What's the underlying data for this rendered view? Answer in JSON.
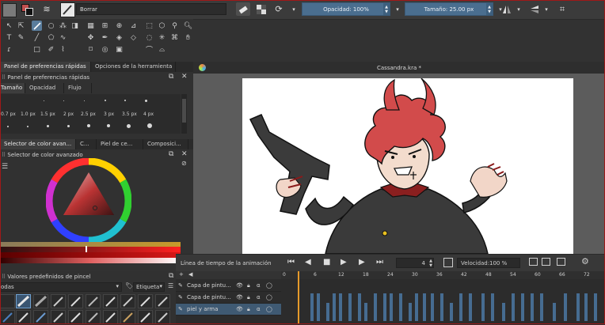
{
  "toolbar": {
    "brush_preset": "Borrar",
    "opacity": "Opacidad: 100%",
    "size": "Tamaño: 25.00 px"
  },
  "tabs_top": [
    "Panel de preferencias rápidas",
    "Opciones de la herramienta"
  ],
  "quick_panel": {
    "title": "Panel de preferencias rápidas",
    "tabs": [
      "Tamaño",
      "Opacidad",
      "Flujo"
    ],
    "sizes": [
      "0.7 px",
      "1.0 px",
      "1.5 px",
      "2 px",
      "2.5 px",
      "3 px",
      "3.5 px",
      "4 px"
    ]
  },
  "color_tabs": [
    "Selector de color avan...",
    "C...",
    "Piel de ce...",
    "Composici..."
  ],
  "color_selector_title": "Selector de color avanzado",
  "presets": {
    "title": "Valores predefinidos de pincel",
    "filter": "odas",
    "tag": "Etiqueta"
  },
  "document": {
    "title": "Cassandra.kra *"
  },
  "animation": {
    "title": "Línea de tiempo de la animación",
    "frame": "4",
    "speed_label": "Velocidad:",
    "speed": "100 %"
  },
  "timeline": {
    "ticks": [
      "0",
      "6",
      "12",
      "18",
      "24",
      "30",
      "36",
      "42",
      "48",
      "54",
      "60",
      "66",
      "72"
    ],
    "layers": [
      "Capa de pintu...",
      "Capa de pintu...",
      "piel y arma"
    ]
  },
  "colors": {
    "accent": "#4a6e8f",
    "fg": "#c0504f",
    "bg": "#ffffff"
  }
}
